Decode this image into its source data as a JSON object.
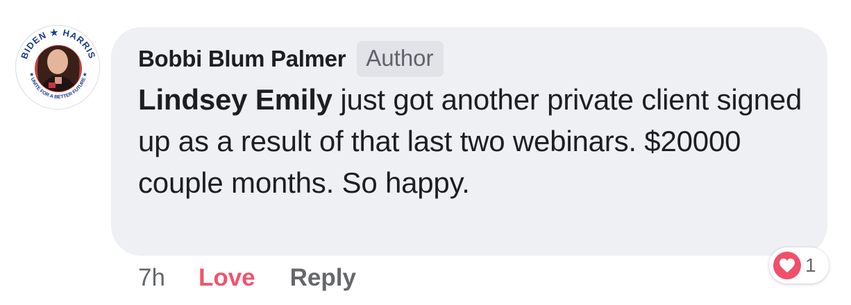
{
  "avatar": {
    "badge_text_top": "BIDEN ★ HARRIS",
    "badge_text_bottom": "★ UNITE FOR A BETTER FUTURE ★"
  },
  "comment": {
    "author_name": "Bobbi Blum Palmer",
    "author_badge": "Author",
    "mention": "Lindsey Emily",
    "body": " just got another private client signed up as a result of that last two webinars. $20000 couple months. So happy."
  },
  "actions": {
    "time": "7h",
    "love_label": "Love",
    "reply_label": "Reply"
  },
  "reaction": {
    "icon": "heart-icon",
    "count": "1"
  },
  "colors": {
    "bubble": "#eff0f4",
    "love": "#f0546b",
    "heart": "#f0506a"
  }
}
